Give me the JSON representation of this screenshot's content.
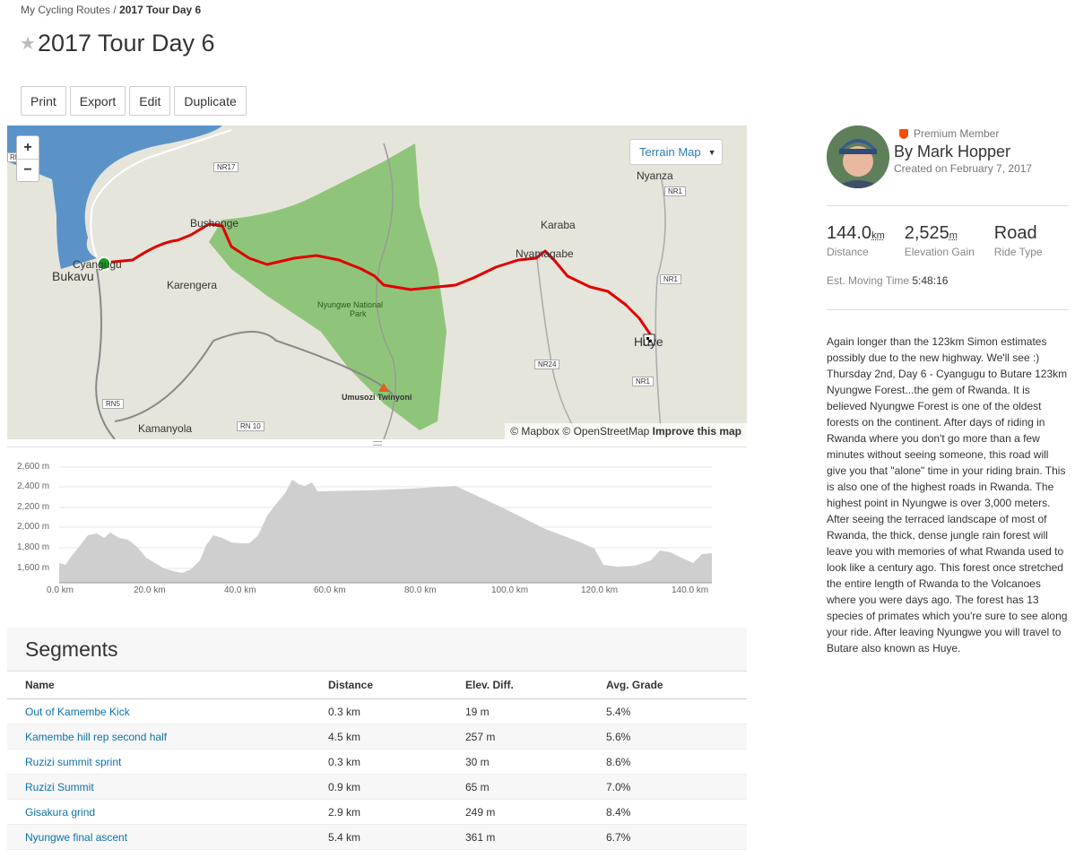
{
  "breadcrumb": {
    "parent": "My Cycling Routes",
    "separator": "/",
    "current": "2017 Tour Day 6"
  },
  "page": {
    "title": "2017 Tour Day 6"
  },
  "toolbar": {
    "print": "Print",
    "export": "Export",
    "edit": "Edit",
    "duplicate": "Duplicate"
  },
  "map": {
    "zoom_in": "+",
    "zoom_out": "−",
    "terrain_label": "Terrain Map",
    "attribution": {
      "mapbox": "© Mapbox",
      "osm": "© OpenStreetMap",
      "improve": "Improve this map"
    },
    "labels": {
      "bukavu": "Bukavu",
      "cyangugu": "Cyangugu",
      "karengera": "Karengera",
      "bushenge": "Bushenge",
      "nyungwe": "Nyungwe National",
      "park": "Park",
      "umusozi": "Umusozi Twinyoni",
      "kamanyola": "Kamanyola",
      "nyanza": "Nyanza",
      "karaba": "Karaba",
      "nyamagabe": "Nyamagabe",
      "huye": "Huye",
      "nr17": "NR17",
      "nr1a": "NR1",
      "nr1b": "NR1",
      "nr1c": "NR1",
      "nr24": "NR24",
      "rn5": "RN5",
      "rn10": "RN 10",
      "rn": "RN"
    },
    "colors": {
      "lake": "#5b93c9",
      "forest": "#8fc57a",
      "route": "#e00000",
      "land": "#e6e5dc"
    }
  },
  "elevation": {
    "y_ticks": [
      "2,600 m",
      "2,400 m",
      "2,200 m",
      "2,000 m",
      "1,800 m",
      "1,600 m"
    ],
    "x_ticks": [
      "0.0 km",
      "20.0 km",
      "40.0 km",
      "60.0 km",
      "80.0 km",
      "100.0 km",
      "120.0 km",
      "140.0 km"
    ]
  },
  "segments": {
    "heading": "Segments",
    "columns": [
      "Name",
      "Distance",
      "Elev. Diff.",
      "Avg. Grade"
    ],
    "rows": [
      {
        "name": "Out of Kamembe Kick",
        "distance": "0.3 km",
        "elev": "19 m",
        "grade": "5.4%"
      },
      {
        "name": "Kamembe hill rep second half",
        "distance": "4.5 km",
        "elev": "257 m",
        "grade": "5.6%"
      },
      {
        "name": "Ruzizi summit sprint",
        "distance": "0.3 km",
        "elev": "30 m",
        "grade": "8.6%"
      },
      {
        "name": "Ruzizi Summit",
        "distance": "0.9 km",
        "elev": "65 m",
        "grade": "7.0%"
      },
      {
        "name": "Gisakura grind",
        "distance": "2.9 km",
        "elev": "249 m",
        "grade": "8.4%"
      },
      {
        "name": "Nyungwe final ascent",
        "distance": "5.4 km",
        "elev": "361 m",
        "grade": "6.7%"
      }
    ]
  },
  "athlete": {
    "badge": "Premium Member",
    "by": "By Mark Hopper",
    "created": "Created on February 7, 2017"
  },
  "stats": {
    "distance": "144.0",
    "distance_unit": "km",
    "distance_label": "Distance",
    "elevation": "2,525",
    "elevation_unit": "m",
    "elevation_label": "Elevation Gain",
    "type": "Road",
    "type_label": "Ride Type",
    "moving_label": "Est. Moving Time",
    "moving_value": "5:48:16"
  },
  "description": "Again longer than the 123km Simon estimates possibly due to the new highway. We'll see :) Thursday 2nd, Day 6 - Cyangugu to Butare 123km Nyungwe Forest...the gem of Rwanda. It is believed Nyungwe Forest is one of the oldest forests on the continent. After days of riding in Rwanda where you don't go more than a few minutes without seeing someone, this road will give you that \"alone\" time in your riding brain. This is also one of the highest roads in Rwanda. The highest point in Nyungwe is over 3,000 meters. After seeing the terraced landscape of most of Rwanda, the thick, dense jungle rain forest will leave you with memories of what Rwanda used to look like a century ago. This forest once stretched the entire length of Rwanda to the Volcanoes where you were days ago. The forest has 13 species of primates which you're sure to see along your ride. After leaving Nyungwe you will travel to Butare also known as Huye."
}
